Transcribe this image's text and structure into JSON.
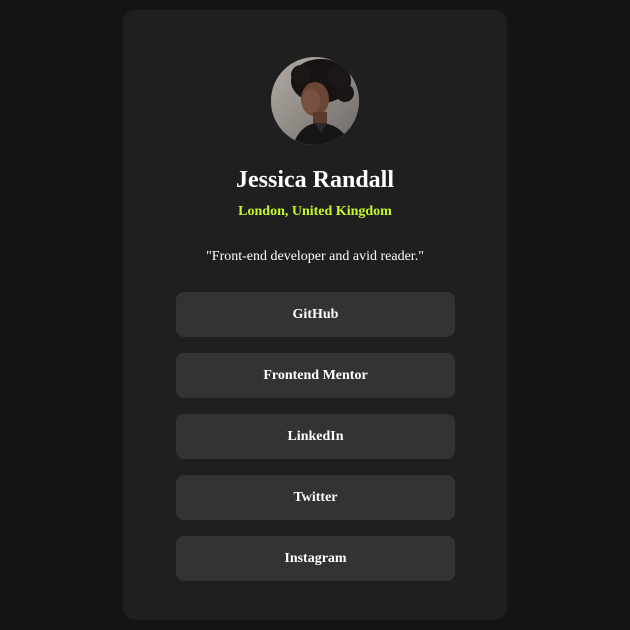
{
  "profile": {
    "name": "Jessica Randall",
    "location": "London, United Kingdom",
    "bio": "\"Front-end developer and avid reader.\""
  },
  "links": [
    {
      "label": "GitHub"
    },
    {
      "label": "Frontend Mentor"
    },
    {
      "label": "LinkedIn"
    },
    {
      "label": "Twitter"
    },
    {
      "label": "Instagram"
    }
  ],
  "colors": {
    "page_background": "#141414",
    "card_background": "#1f1f1f",
    "button_background": "#333333",
    "accent": "#c4f82a",
    "text": "#ffffff"
  }
}
